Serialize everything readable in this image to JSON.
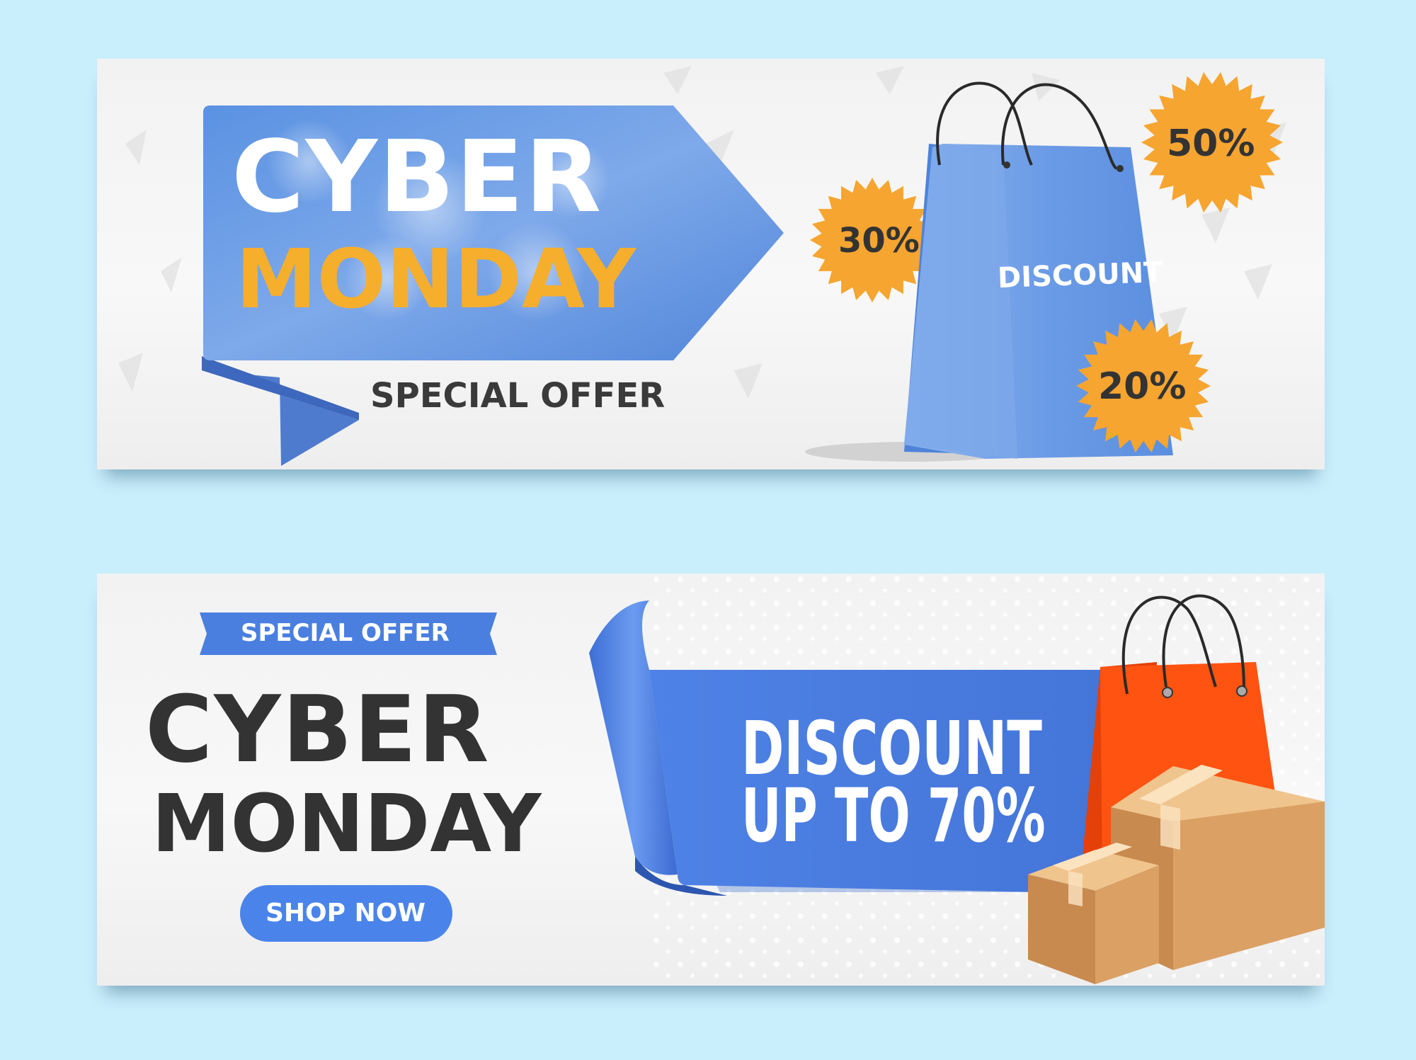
{
  "banner_top": {
    "title_line1": "CYBER",
    "title_line2": "MONDAY",
    "subtitle": "SPECIAL OFFER",
    "bag_label": "DISCOUNT",
    "badges": [
      "30%",
      "50%",
      "20%"
    ]
  },
  "banner_bottom": {
    "ribbon_label": "SPECIAL OFFER",
    "title_line1": "CYBER",
    "title_line2": "MONDAY",
    "shop_button": "SHOP NOW",
    "discount_line1": "DISCOUNT",
    "discount_line2": "UP TO 70%"
  },
  "colors": {
    "page_bg": "#c9eefc",
    "ribbon_blue": "#5b8fe0",
    "title_orange": "#f6ae2d",
    "dark_text": "#333333",
    "badge_orange": "#f6a531",
    "bag_red": "#ff5311",
    "box_tan": "#dba064"
  }
}
